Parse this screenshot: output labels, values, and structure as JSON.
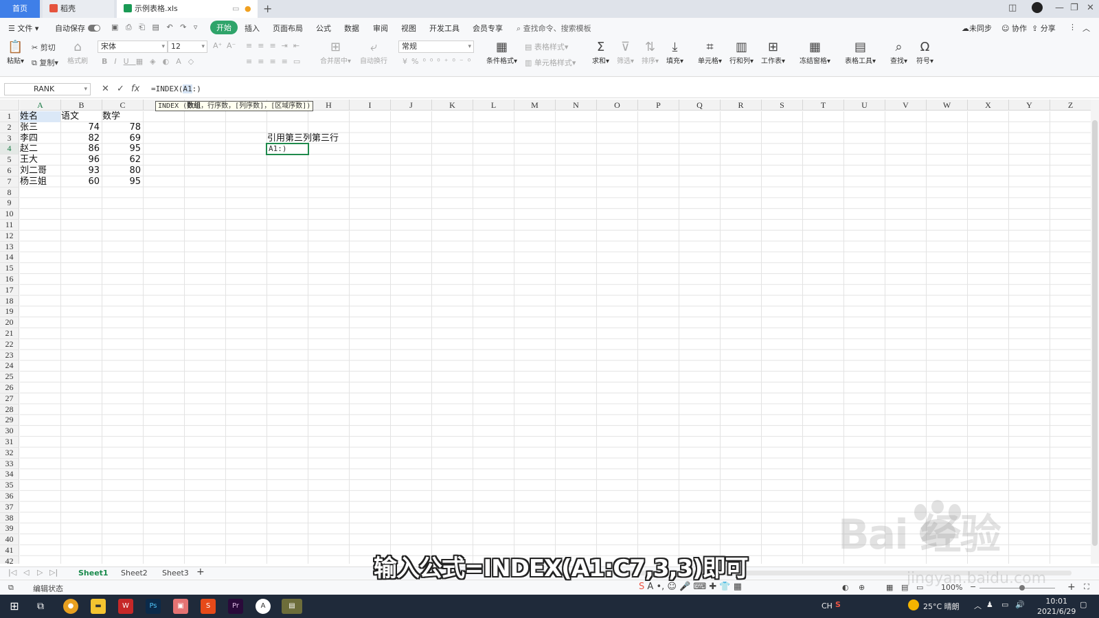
{
  "tabs": {
    "home": "首页",
    "daoke": "稻壳",
    "file": "示例表格.xls"
  },
  "menu": {
    "file": "文件",
    "autosave": "自动保存",
    "start": "开始",
    "items": [
      "插入",
      "页面布局",
      "公式",
      "数据",
      "审阅",
      "视图",
      "开发工具",
      "会员专享"
    ],
    "search": "查找命令、搜索模板",
    "unsynced": "未同步",
    "collab": "协作",
    "share": "分享"
  },
  "ribbon": {
    "paste": "粘贴",
    "cut": "剪切",
    "copy": "复制",
    "format_painter": "格式刷",
    "font": "宋体",
    "font_size": "12",
    "merge": "合并居中",
    "wrap": "自动换行",
    "number_format": "常规",
    "conditional": "条件格式",
    "table_style": "表格样式",
    "cell_style": "单元格样式",
    "sum": "求和",
    "filter": "筛选",
    "sort": "排序",
    "fill": "填充",
    "cell": "单元格",
    "row_col": "行和列",
    "sheet": "工作表",
    "freeze": "冻结窗格",
    "table_tools": "表格工具",
    "find": "查找",
    "symbol": "符号"
  },
  "formula_bar": {
    "name_box": "RANK",
    "fx": "fx",
    "prefix": "=INDEX(",
    "selected_ref": "A1",
    "suffix": ":)"
  },
  "tooltip": {
    "fn": "INDEX",
    "arg1": "数组",
    "rest": "，行序数，[列序数]，[区域序数])"
  },
  "columns": [
    "A",
    "B",
    "C",
    "D",
    "E",
    "F",
    "G",
    "H",
    "I",
    "J",
    "K",
    "L",
    "M",
    "N",
    "O",
    "P",
    "Q",
    "R",
    "S",
    "T",
    "U",
    "V",
    "W",
    "X",
    "Y",
    "Z"
  ],
  "rows_count": 42,
  "table": {
    "headers": [
      "姓名",
      "语文",
      "数学"
    ],
    "rows": [
      [
        "张三",
        "74",
        "78"
      ],
      [
        "李四",
        "82",
        "69"
      ],
      [
        "赵二",
        "86",
        "95"
      ],
      [
        "王大",
        "96",
        "62"
      ],
      [
        "刘二哥",
        "93",
        "80"
      ],
      [
        "杨三姐",
        "60",
        "95"
      ]
    ]
  },
  "note_cell": "引用第三列第三行",
  "edit_cell": "A1:)",
  "sheets": [
    "Sheet1",
    "Sheet2",
    "Sheet3"
  ],
  "status": {
    "mode": "编辑状态",
    "zoom": "100%"
  },
  "caption": "输入公式=INDEX(A1:C7,3,3)即可",
  "watermark": {
    "brand": "Bai  经验",
    "url": "jingyan.baidu.com"
  },
  "taskbar": {
    "weather": "25°C 晴朗",
    "time": "10:01",
    "date": "2021/6/29",
    "ime": "CH"
  },
  "colors": {
    "accent_green": "#2fa46a",
    "tab_blue": "#3f7fe8",
    "selection_green": "#1f8a4c"
  }
}
